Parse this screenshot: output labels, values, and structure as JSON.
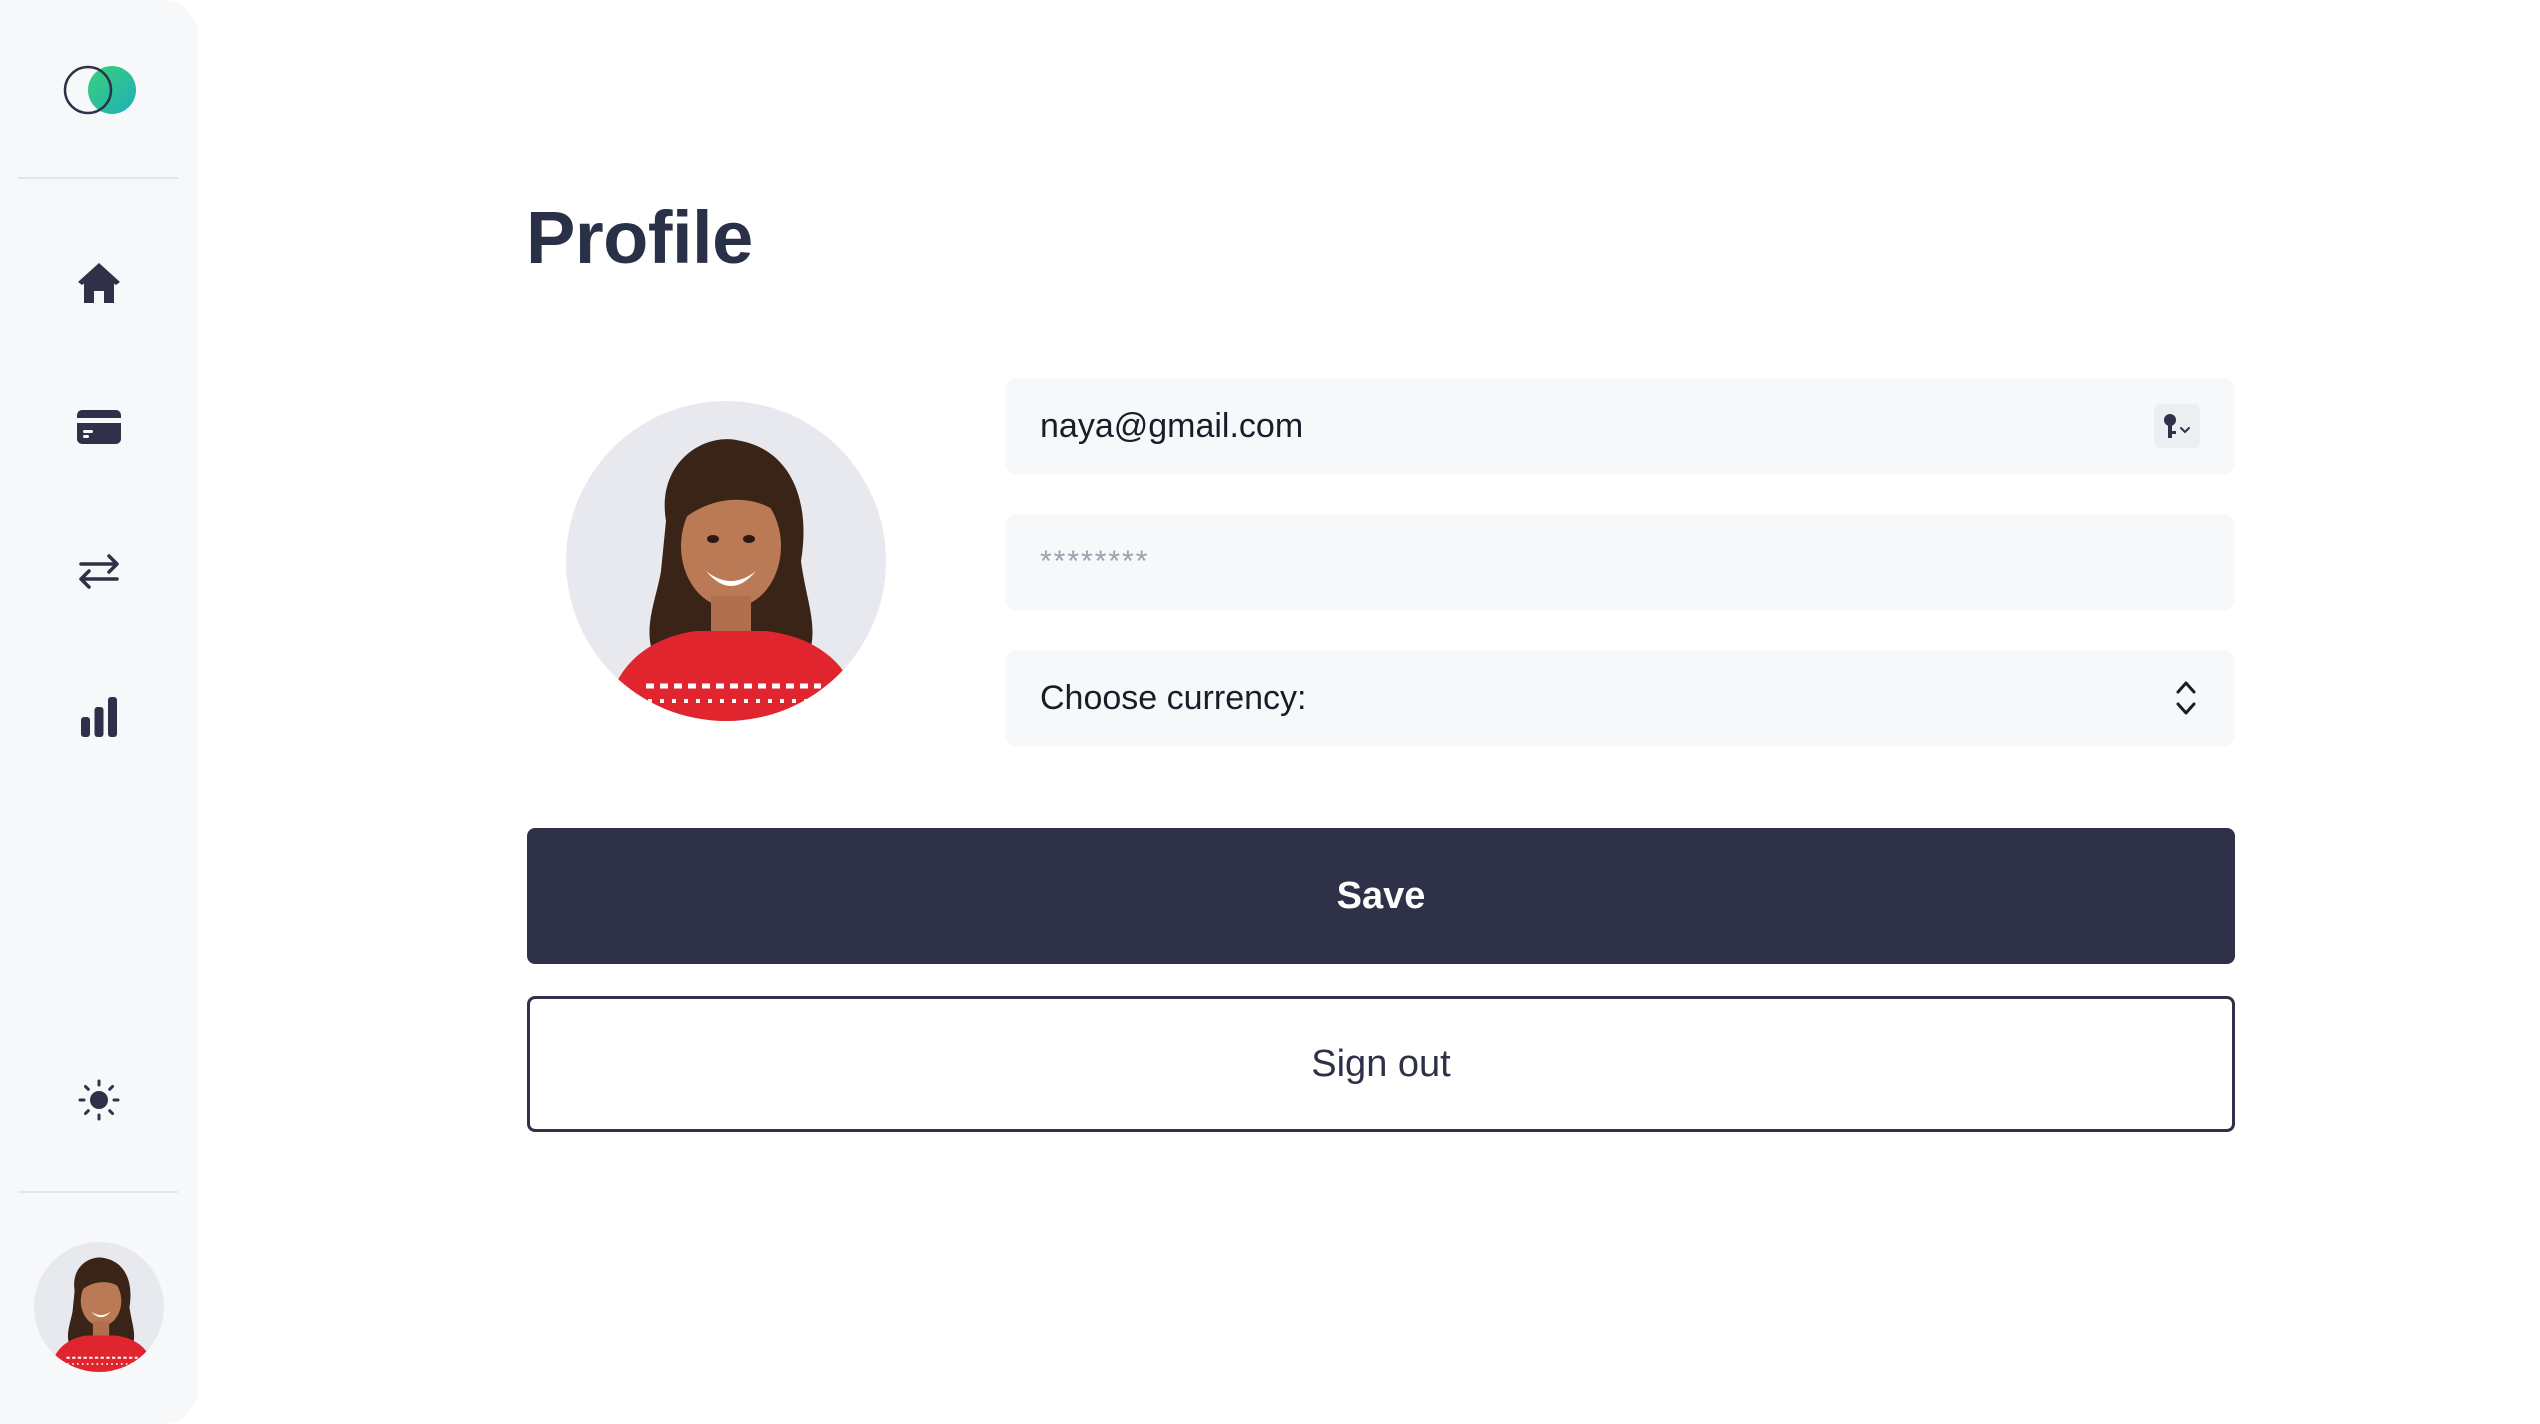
{
  "page": {
    "title": "Profile"
  },
  "sidebar": {
    "logo_icon": "two-circles-logo",
    "items": [
      {
        "icon": "home-icon",
        "label": "Home"
      },
      {
        "icon": "credit-card-icon",
        "label": "Cards"
      },
      {
        "icon": "transfer-arrows-icon",
        "label": "Transfers"
      },
      {
        "icon": "bar-chart-icon",
        "label": "Statistics"
      }
    ],
    "theme_toggle_icon": "sun-icon",
    "user_avatar": "user-avatar"
  },
  "form": {
    "email": {
      "value": "naya@gmail.com",
      "icon": "key-dropdown-icon"
    },
    "password": {
      "value": "",
      "placeholder": "********"
    },
    "currency": {
      "label": "Choose currency:",
      "icon": "chevron-up-down-icon"
    }
  },
  "actions": {
    "save_label": "Save",
    "signout_label": "Sign out"
  },
  "colors": {
    "primary": "#2e3148",
    "sidebar_bg": "#f7f8fa",
    "field_bg": "#f7f8fa",
    "logo_green": "#2ecc8f",
    "logo_teal": "#22b3b0",
    "avatar_shirt": "#e0252f"
  }
}
